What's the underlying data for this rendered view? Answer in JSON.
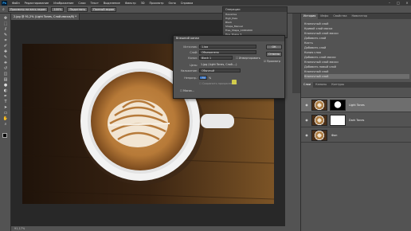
{
  "app": {
    "logo": "Ps"
  },
  "menubar": {
    "items": [
      "Файл",
      "Редактирование",
      "Изображение",
      "Слои",
      "Текст",
      "Выделение",
      "Фильтр",
      "3D",
      "Просмотр",
      "Окно",
      "Справка"
    ],
    "window_controls": [
      "–",
      "□",
      "×"
    ]
  },
  "options_bar": {
    "buttons": [
      "Просмотр на весь экран",
      "100%",
      "Подогнать"
    ],
    "text": "Полный экран"
  },
  "document": {
    "tab_title": "2.jpg @ 91,2% (Light Tones, Слой-маска/8) *",
    "status": "91,17%"
  },
  "toolbar": {
    "tools": [
      "move-icon",
      "marquee-icon",
      "lasso-icon",
      "quick-select-icon",
      "crop-icon",
      "eyedropper-icon",
      "healing-icon",
      "brush-icon",
      "stamp-icon",
      "history-brush-icon",
      "eraser-icon",
      "gradient-icon",
      "blur-icon",
      "dodge-icon",
      "pen-icon",
      "type-icon",
      "path-select-icon",
      "shape-icon",
      "hand-icon",
      "zoom-icon"
    ],
    "glyphs": [
      "✥",
      "⬚",
      "ℓ",
      "✎",
      "⌗",
      "✐",
      "✚",
      "✎",
      "⎈",
      "↺",
      "◫",
      "▤",
      "●",
      "◐",
      "✒",
      "T",
      "➤",
      "▭",
      "✋",
      "⌕"
    ]
  },
  "float_panel": {
    "title": "Операции",
    "rows": [
      "Нажатие",
      "High_Pass",
      "Black",
      "Shape_Manual",
      "Free_Shape_1000x600",
      "Fine_Shape_5"
    ]
  },
  "dialog": {
    "title": "Внешний канал",
    "labels": {
      "source": "Источник:",
      "layer": "Слой:",
      "channel": "Канал:",
      "target": "Цель:",
      "blending": "Наложение:",
      "opacity": "Непрозр.:",
      "mask": "Маска..."
    },
    "values": {
      "source": "1.jpg",
      "layer": "Объединено",
      "channel": "Black 1",
      "target": "1.jpg (Light Tones, Слой-...)",
      "blending": "Обычный",
      "opacity": "75",
      "opacity_unit": "%"
    },
    "checks": {
      "invert": "Инвертировать",
      "preserve": "Сохранить прозрачность",
      "preview": "Просмотр"
    },
    "buttons": {
      "ok": "ОК",
      "cancel": "Отмена"
    }
  },
  "right_panel": {
    "history_tabs": [
      "История",
      "Инфо",
      "Свойства",
      "Навигатор"
    ],
    "history": [
      "Кнопочный слой",
      "Кривой слой маски",
      "Кнопочный слой маски",
      "Добавить слой",
      "Кисть",
      "Добавить слой",
      "Копия слоя",
      "Добавить слой маски",
      "Кнопочный слой маски",
      "Добавить новый слой",
      "Кнопочный слой",
      "Кнопочный слой"
    ],
    "layer_tabs": [
      "Слои",
      "Каналы",
      "Контуры"
    ],
    "layers": [
      {
        "name": "Light Tones",
        "active": true,
        "mask": "white-blob"
      },
      {
        "name": "Dark Tones",
        "active": false,
        "mask": "white"
      },
      {
        "name": "Фон",
        "active": false,
        "mask": "none"
      }
    ]
  }
}
